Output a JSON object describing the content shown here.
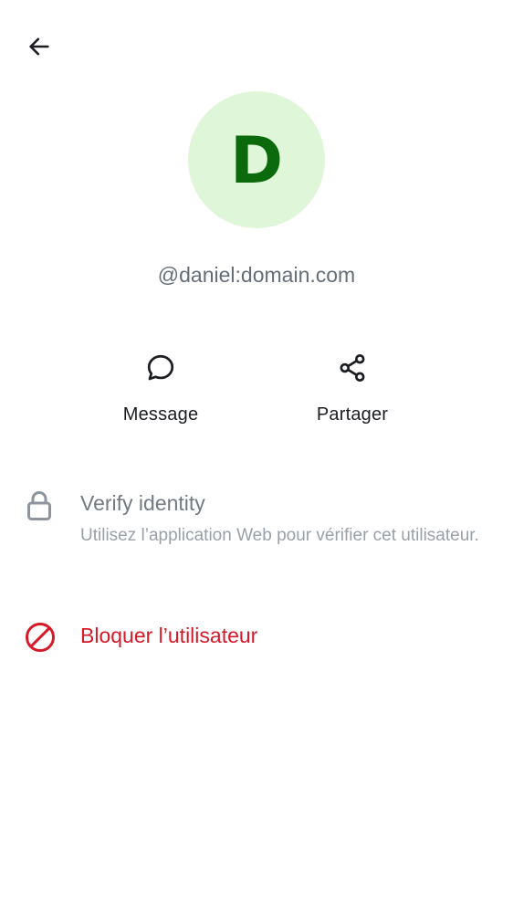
{
  "header": {
    "back_icon": "arrow-left-icon"
  },
  "profile": {
    "avatar_letter": "D",
    "avatar_bg": "#dff6d8",
    "avatar_fg": "#0b6a0b",
    "user_id": "@daniel:domain.com"
  },
  "actions": [
    {
      "label": "Message",
      "icon": "chat-bubble-icon"
    },
    {
      "label": "Partager",
      "icon": "share-icon"
    }
  ],
  "verify": {
    "icon": "lock-icon",
    "title": "Verify identity",
    "subtitle": "Utilisez l’application Web pour vérifier cet utilisateur."
  },
  "block": {
    "icon": "block-icon",
    "label": "Bloquer l’utilisateur",
    "color": "#d51928"
  }
}
